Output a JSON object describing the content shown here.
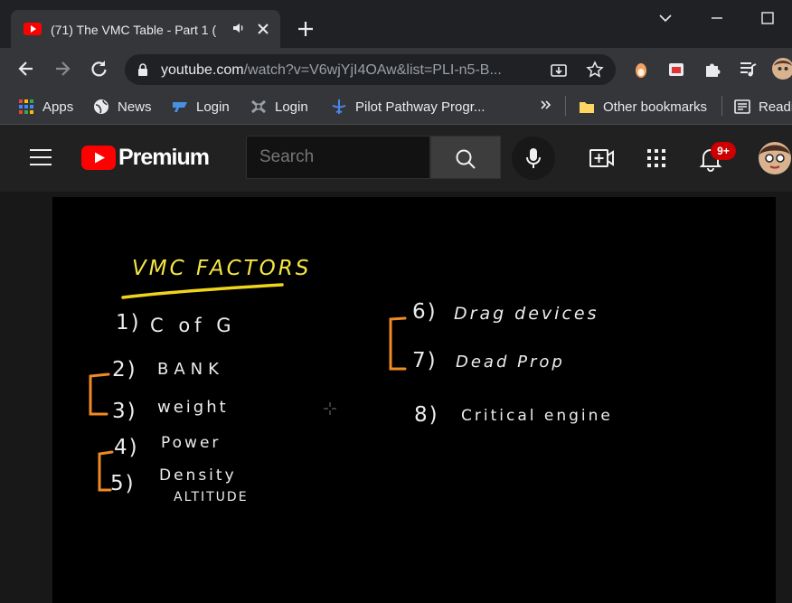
{
  "tab": {
    "title": "(71) The VMC Table - Part 1 (",
    "favicon": "youtube-favicon-icon"
  },
  "omnibox": {
    "host": "youtube.com",
    "path": "/watch?v=V6wjYjI4OAw&list=PLI-n5-B..."
  },
  "bookmarks": [
    {
      "label": "Apps",
      "icon": "apps-grid-icon"
    },
    {
      "label": "News",
      "icon": "globe-icon"
    },
    {
      "label": "Login",
      "icon": "login-icon"
    },
    {
      "label": "Login",
      "icon": "login-icon"
    },
    {
      "label": "Pilot Pathway Progr...",
      "icon": "plane-icon"
    },
    {
      "label": "Other bookmarks",
      "icon": "folder-icon"
    },
    {
      "label": "Readi",
      "icon": "reading-list-icon"
    }
  ],
  "youtube": {
    "logo_text": "Premium",
    "search_placeholder": "Search",
    "notification_badge": "9+",
    "brand_red": "#ff0000"
  },
  "whiteboard": {
    "title": "VMC FACTORS",
    "left_items": [
      {
        "number": "1)",
        "label": "C of G"
      },
      {
        "number": "2)",
        "label": "BANK"
      },
      {
        "number": "3)",
        "label": "weight"
      },
      {
        "number": "4)",
        "label": "Power"
      },
      {
        "number": "5)",
        "label": "Density"
      }
    ],
    "item5_line2": "ALTITUDE",
    "right_items": [
      {
        "number": "6)",
        "label": "Drag devices"
      },
      {
        "number": "7)",
        "label": "Dead Prop"
      },
      {
        "number": "8)",
        "label": "Critical engine"
      }
    ],
    "title_color": "#f5e642",
    "underline_color": "#f0d51c",
    "bracket_color": "#f08a24",
    "ink_color": "#ececec"
  }
}
